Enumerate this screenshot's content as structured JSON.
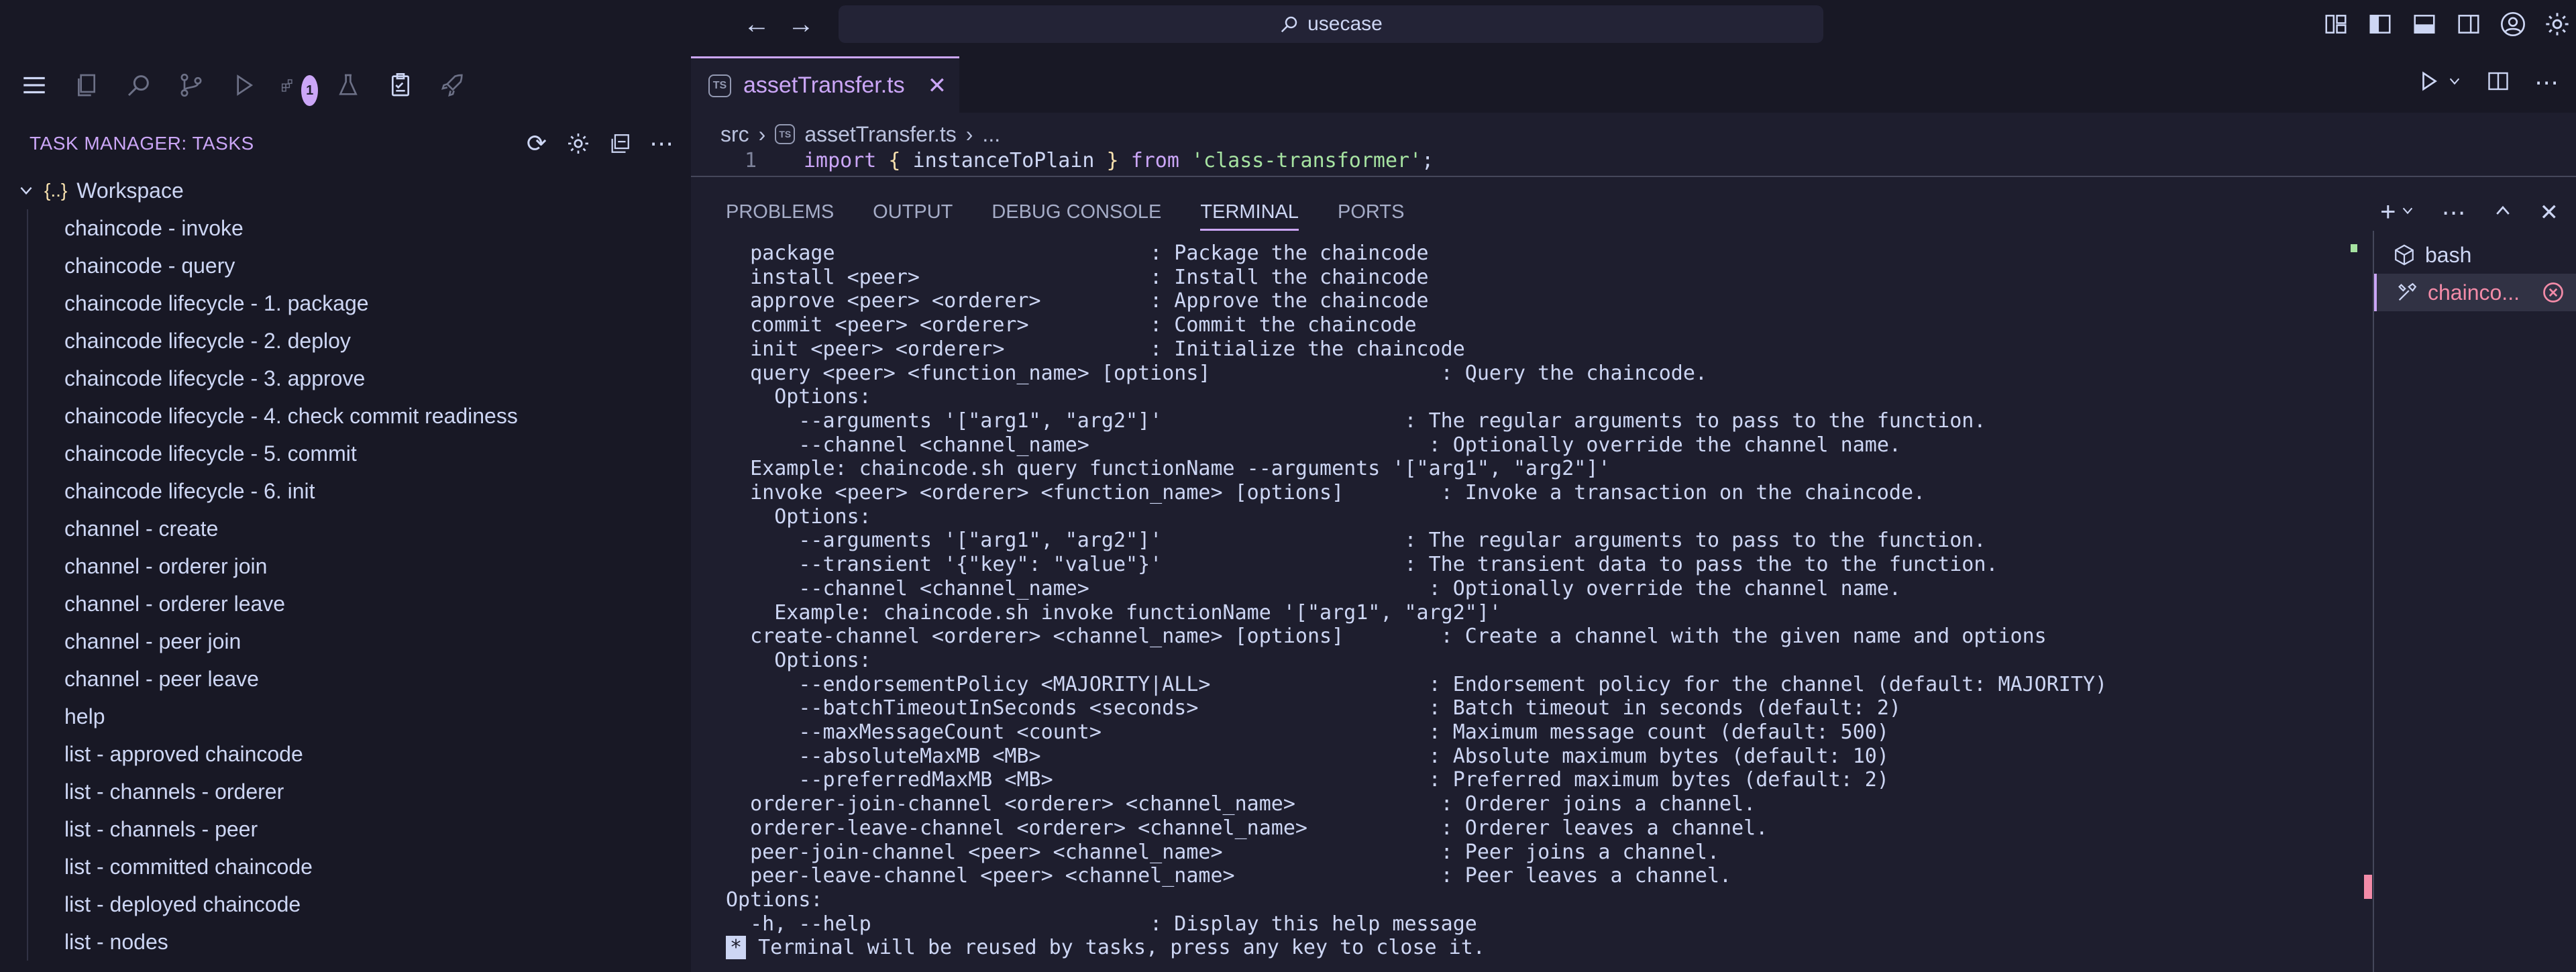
{
  "titlebar": {
    "search_text": "usecase"
  },
  "sidebar": {
    "panel_title": "TASK MANAGER: TASKS",
    "badge_count": "1",
    "root_label": "Workspace",
    "tasks": [
      "chaincode - invoke",
      "chaincode - query",
      "chaincode lifecycle - 1. package",
      "chaincode lifecycle - 2. deploy",
      "chaincode lifecycle - 3. approve",
      "chaincode lifecycle - 4. check commit readiness",
      "chaincode lifecycle - 5. commit",
      "chaincode lifecycle - 6. init",
      "channel - create",
      "channel - orderer join",
      "channel - orderer leave",
      "channel - peer join",
      "channel - peer leave",
      "help",
      "list - approved chaincode",
      "list - channels - orderer",
      "list - channels - peer",
      "list - committed chaincode",
      "list - deployed chaincode",
      "list - nodes"
    ]
  },
  "editor": {
    "tab_label": "assetTransfer.ts",
    "tab_icon_text": "TS",
    "breadcrumb": {
      "folder": "src",
      "file": "assetTransfer.ts",
      "more": "..."
    },
    "code_line_number": "1",
    "code_line": {
      "kw1": "import",
      "brace_open": " { ",
      "ident": "instanceToPlain",
      "brace_close": " } ",
      "kw2": "from",
      "module": " 'class-transformer'",
      "semi": ";"
    }
  },
  "panel": {
    "tabs": [
      "PROBLEMS",
      "OUTPUT",
      "DEBUG CONSOLE",
      "TERMINAL",
      "PORTS"
    ],
    "active_tab": "TERMINAL",
    "terminals": [
      {
        "label": "bash"
      },
      {
        "label": "chainco..."
      }
    ],
    "terminal_lines": [
      "  package                          : Package the chaincode",
      "  install <peer>                   : Install the chaincode",
      "  approve <peer> <orderer>         : Approve the chaincode",
      "  commit <peer> <orderer>          : Commit the chaincode",
      "  init <peer> <orderer>            : Initialize the chaincode",
      "  query <peer> <function_name> [options]                   : Query the chaincode.",
      "    Options:",
      "      --arguments '[\"arg1\", \"arg2\"]'                    : The regular arguments to pass to the function.",
      "      --channel <channel_name>                            : Optionally override the channel name.",
      "  Example: chaincode.sh query functionName --arguments '[\"arg1\", \"arg2\"]'",
      "  invoke <peer> <orderer> <function_name> [options]        : Invoke a transaction on the chaincode.",
      "    Options:",
      "      --arguments '[\"arg1\", \"arg2\"]'                    : The regular arguments to pass to the function.",
      "      --transient '{\"key\": \"value\"}'                    : The transient data to pass the to the function.",
      "      --channel <channel_name>                            : Optionally override the channel name.",
      "    Example: chaincode.sh invoke functionName '[\"arg1\", \"arg2\"]'",
      "  create-channel <orderer> <channel_name> [options]        : Create a channel with the given name and options",
      "    Options:",
      "      --endorsementPolicy <MAJORITY|ALL>                  : Endorsement policy for the channel (default: MAJORITY)",
      "      --batchTimeoutInSeconds <seconds>                   : Batch timeout in seconds (default: 2)",
      "      --maxMessageCount <count>                           : Maximum message count (default: 500)",
      "      --absoluteMaxMB <MB>                                : Absolute maximum bytes (default: 10)",
      "      --preferredMaxMB <MB>                               : Preferred maximum bytes (default: 2)",
      "  orderer-join-channel <orderer> <channel_name>            : Orderer joins a channel.",
      "  orderer-leave-channel <orderer> <channel_name>           : Orderer leaves a channel.",
      "  peer-join-channel <peer> <channel_name>                  : Peer joins a channel.",
      "  peer-leave-channel <peer> <channel_name>                 : Peer leaves a channel.",
      "Options:",
      "  -h, --help                       : Display this help message"
    ],
    "terminal_prompt_marker": "*",
    "terminal_footer": " Terminal will be reused by tasks, press any key to close it."
  }
}
